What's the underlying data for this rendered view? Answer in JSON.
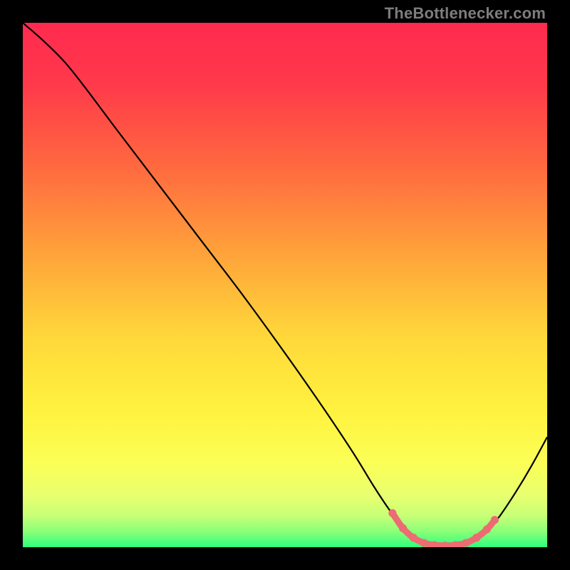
{
  "attribution": "TheBottlenecker.com",
  "chart_data": {
    "type": "line",
    "title": "",
    "xlabel": "",
    "ylabel": "",
    "xlim": [
      0,
      100
    ],
    "ylim": [
      0,
      100
    ],
    "background_gradient": {
      "stops": [
        {
          "offset": 0,
          "color": "#ff2a4f"
        },
        {
          "offset": 12,
          "color": "#ff3a4a"
        },
        {
          "offset": 28,
          "color": "#ff6b3f"
        },
        {
          "offset": 45,
          "color": "#ffa63a"
        },
        {
          "offset": 60,
          "color": "#ffd83a"
        },
        {
          "offset": 74,
          "color": "#fff23f"
        },
        {
          "offset": 84,
          "color": "#fbff56"
        },
        {
          "offset": 90,
          "color": "#e9ff6f"
        },
        {
          "offset": 94,
          "color": "#c7ff77"
        },
        {
          "offset": 97,
          "color": "#8bff78"
        },
        {
          "offset": 100,
          "color": "#2dff7d"
        }
      ]
    },
    "series": [
      {
        "name": "bottleneck-curve",
        "color": "#000000",
        "width": 2.2,
        "points": [
          {
            "x": 0,
            "y": 100
          },
          {
            "x": 4,
            "y": 96.5
          },
          {
            "x": 8,
            "y": 92.5
          },
          {
            "x": 12,
            "y": 87.5
          },
          {
            "x": 18,
            "y": 79.5
          },
          {
            "x": 26,
            "y": 69
          },
          {
            "x": 34,
            "y": 58.5
          },
          {
            "x": 42,
            "y": 48
          },
          {
            "x": 50,
            "y": 37
          },
          {
            "x": 57,
            "y": 27
          },
          {
            "x": 63,
            "y": 18
          },
          {
            "x": 67,
            "y": 11.5
          },
          {
            "x": 70,
            "y": 7
          },
          {
            "x": 73,
            "y": 3.2
          },
          {
            "x": 75,
            "y": 1.4
          },
          {
            "x": 77,
            "y": 0.5
          },
          {
            "x": 79,
            "y": 0.2
          },
          {
            "x": 81,
            "y": 0.2
          },
          {
            "x": 83,
            "y": 0.3
          },
          {
            "x": 85,
            "y": 0.8
          },
          {
            "x": 87,
            "y": 1.8
          },
          {
            "x": 89,
            "y": 3.6
          },
          {
            "x": 91,
            "y": 6.0
          },
          {
            "x": 94,
            "y": 10.5
          },
          {
            "x": 97,
            "y": 15.5
          },
          {
            "x": 100,
            "y": 21
          }
        ]
      },
      {
        "name": "optimal-range-band",
        "color": "#ed6b72",
        "width": 9,
        "linecap": "round",
        "points": [
          {
            "x": 70.5,
            "y": 6.5
          },
          {
            "x": 72.5,
            "y": 3.6
          },
          {
            "x": 74.5,
            "y": 1.8
          },
          {
            "x": 76.5,
            "y": 0.8
          },
          {
            "x": 78.5,
            "y": 0.4
          },
          {
            "x": 80.5,
            "y": 0.3
          },
          {
            "x": 82.5,
            "y": 0.4
          },
          {
            "x": 84.5,
            "y": 0.8
          },
          {
            "x": 86.5,
            "y": 1.8
          },
          {
            "x": 88.5,
            "y": 3.4
          },
          {
            "x": 90.0,
            "y": 5.2
          }
        ]
      }
    ]
  }
}
